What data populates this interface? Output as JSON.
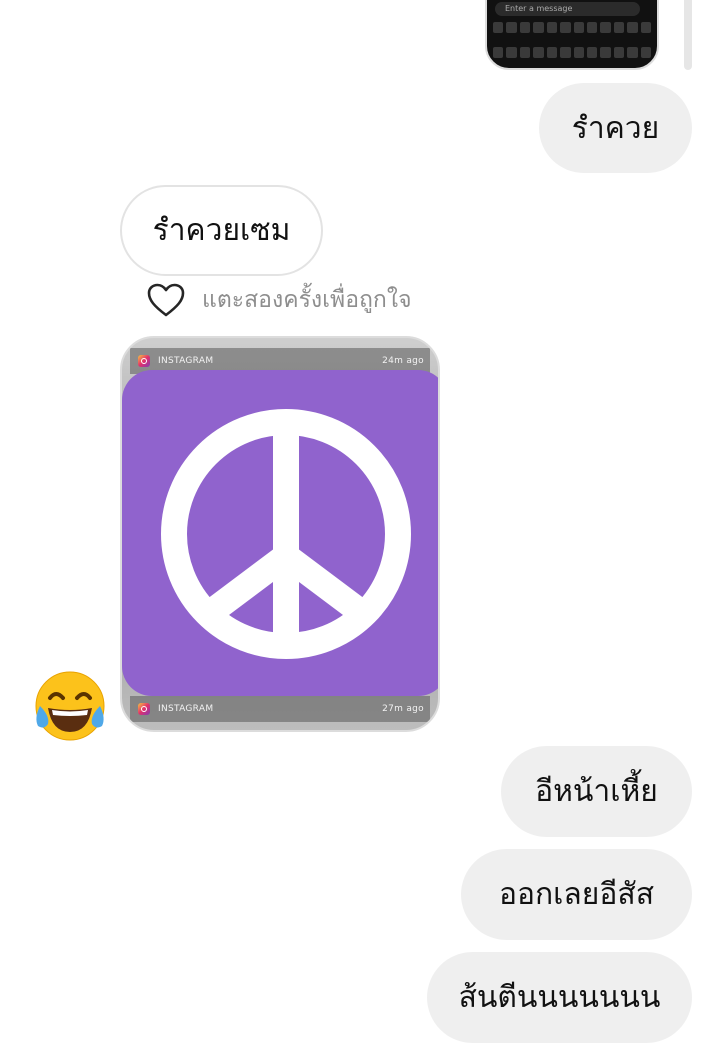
{
  "thread": {
    "top_media": {
      "preview_text": "Enter a message"
    },
    "messages": [
      {
        "side": "sent",
        "text": "รำควย"
      },
      {
        "side": "received",
        "text": "รำควยเซม"
      },
      {
        "side": "sent",
        "text": "อีหน้าเหี้ย"
      },
      {
        "side": "sent",
        "text": "ออกเลยอีสัส"
      },
      {
        "side": "sent",
        "text": "ส้นตีนนนนนนน"
      }
    ],
    "like_hint": "แตะสองครั้งเพื่อถูกใจ",
    "shared_card": {
      "notifications": [
        {
          "app": "INSTAGRAM",
          "time": "24m ago"
        },
        {
          "app": "INSTAGRAM",
          "time": "27m ago"
        }
      ],
      "sticker": "peace-sign",
      "sticker_color": "#9063cd"
    },
    "reaction_emoji": "face-with-tears-of-joy"
  }
}
